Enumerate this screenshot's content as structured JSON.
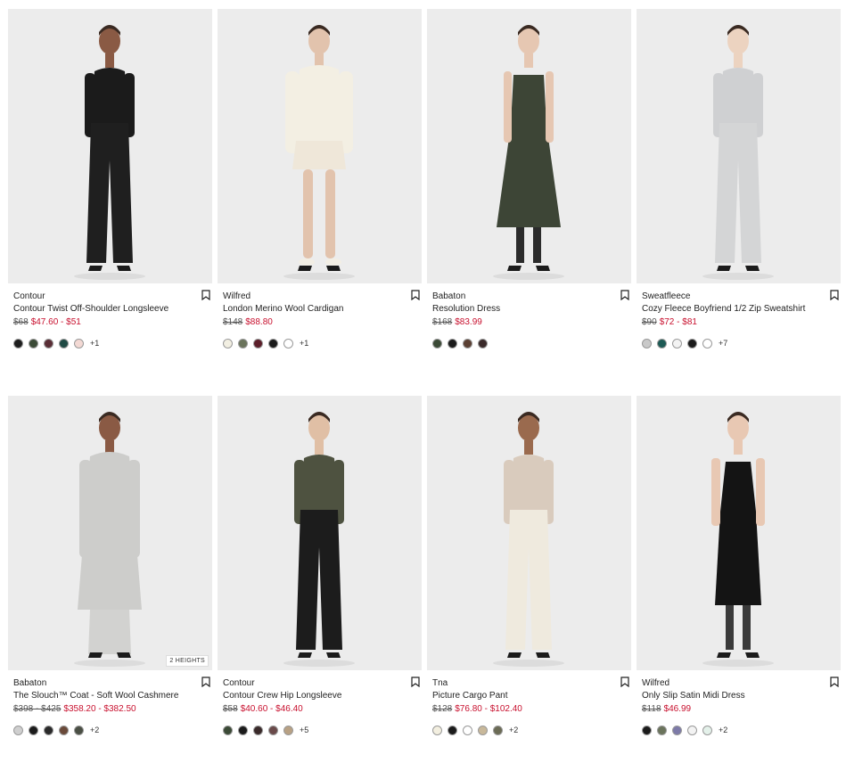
{
  "products": [
    {
      "brand": "Contour",
      "name": "Contour Twist Off-Shoulder Longsleeve",
      "original_price": "$68",
      "sale_price": "$47.60 - $51",
      "swatches": [
        "#1e1e1e",
        "#3b4a36",
        "#5a2e36",
        "#1f4a44",
        "#f3d9d4"
      ],
      "more": "+1",
      "height_tag": "",
      "look": {
        "top": "#1b1b1b",
        "bottom": "#1f1f1f",
        "skin": "#8a5a44",
        "style": "pants"
      }
    },
    {
      "brand": "Wilfred",
      "name": "London Merino Wool Cardigan",
      "original_price": "$148",
      "sale_price": "$88.80",
      "swatches": [
        "#f2efe2",
        "#6b745c",
        "#5c1f2a",
        "#1b1b1b",
        "#ffffff"
      ],
      "more": "+1",
      "height_tag": "",
      "look": {
        "top": "#f3efe3",
        "bottom": "#efe7d9",
        "skin": "#e2c3ad",
        "style": "skirt"
      }
    },
    {
      "brand": "Babaton",
      "name": "Resolution Dress",
      "original_price": "$168",
      "sale_price": "$83.99",
      "swatches": [
        "#3b4a36",
        "#1b1b1b",
        "#5b4033",
        "#3a2a2a"
      ],
      "more": "",
      "height_tag": "",
      "look": {
        "top": "#3d4536",
        "bottom": "#3d4536",
        "skin": "#e6c7b2",
        "style": "dress"
      }
    },
    {
      "brand": "Sweatfleece",
      "name": "Cozy Fleece Boyfriend 1/2 Zip Sweatshirt",
      "original_price": "$90",
      "sale_price": "$72 - $81",
      "swatches": [
        "#c9c9c9",
        "#1d5a55",
        "#f3f3f3",
        "#1b1b1b",
        "#ffffff"
      ],
      "more": "+7",
      "height_tag": "",
      "look": {
        "top": "#cfd0d2",
        "bottom": "#d4d5d6",
        "skin": "#ecd3c0",
        "style": "pants"
      }
    },
    {
      "brand": "Babaton",
      "name": "The Slouch™ Coat - Soft Wool Cashmere",
      "original_price": "$398 - $425",
      "sale_price": "$358.20 - $382.50",
      "swatches": [
        "#cfcfcf",
        "#1b1b1b",
        "#2a2a2a",
        "#6a4a3a",
        "#4a4f44"
      ],
      "more": "+2",
      "height_tag": "2 HEIGHTS",
      "look": {
        "top": "#cdcdcb",
        "bottom": "#d2d2d0",
        "skin": "#8a5a44",
        "style": "coat"
      }
    },
    {
      "brand": "Contour",
      "name": "Contour Crew Hip Longsleeve",
      "original_price": "$58",
      "sale_price": "$40.60 - $46.40",
      "swatches": [
        "#3b4a36",
        "#1b1b1b",
        "#3a2a2a",
        "#6a4a4a",
        "#b8a184"
      ],
      "more": "+5",
      "height_tag": "",
      "look": {
        "top": "#4e5240",
        "bottom": "#1c1c1c",
        "skin": "#e0bfa5",
        "style": "pants"
      }
    },
    {
      "brand": "Tna",
      "name": "Picture Cargo Pant",
      "original_price": "$128",
      "sale_price": "$76.80 - $102.40",
      "swatches": [
        "#f3efe0",
        "#1b1b1b",
        "#ffffff",
        "#c8b89a",
        "#6b6b55"
      ],
      "more": "+2",
      "height_tag": "",
      "look": {
        "top": "#d9cbbd",
        "bottom": "#efeade",
        "skin": "#9a6a4e",
        "style": "pants"
      }
    },
    {
      "brand": "Wilfred",
      "name": "Only Slip Satin Midi Dress",
      "original_price": "$118",
      "sale_price": "$46.99",
      "swatches": [
        "#1b1b1b",
        "#6b745c",
        "#7d7aa8",
        "#f3f3f3",
        "#e4f1ea"
      ],
      "more": "+2",
      "height_tag": "",
      "look": {
        "top": "#141414",
        "bottom": "#141414",
        "skin": "#e8c8b3",
        "style": "slip"
      }
    }
  ]
}
